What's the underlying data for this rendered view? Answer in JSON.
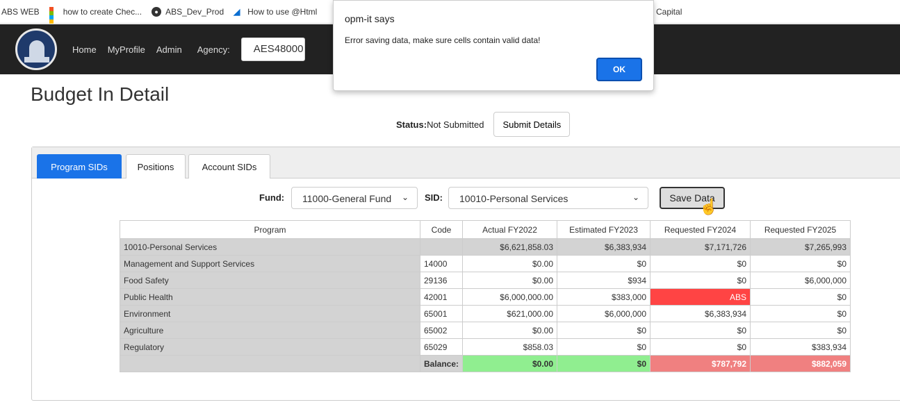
{
  "bookmarks": [
    {
      "label": "ABS WEB",
      "icon": "none"
    },
    {
      "label": "how to create Chec...",
      "icon": "microsoft-icon"
    },
    {
      "label": "ABS_Dev_Prod",
      "icon": "github-icon"
    },
    {
      "label": "How to use @Html",
      "icon": "azure-icon"
    },
    {
      "label": "Capital",
      "icon": "none"
    }
  ],
  "nav": {
    "home": "Home",
    "profile": "MyProfile",
    "admin": "Admin",
    "agency_label": "Agency:",
    "agency_value": "AES48000"
  },
  "page": {
    "title": "Budget In Detail",
    "status_label": "Status:",
    "status_value": "Not Submitted",
    "submit_label": "Submit Details"
  },
  "tabs": [
    {
      "label": "Program SIDs",
      "active": true
    },
    {
      "label": "Positions",
      "active": false
    },
    {
      "label": "Account SIDs",
      "active": false
    }
  ],
  "filters": {
    "fund_label": "Fund:",
    "fund_value": "11000-General Fund",
    "sid_label": "SID:",
    "sid_value": "10010-Personal Services",
    "save_label": "Save Data"
  },
  "table": {
    "headers": [
      "Program",
      "Code",
      "Actual FY2022",
      "Estimated FY2023",
      "Requested FY2024",
      "Requested FY2025"
    ],
    "summary": {
      "program": "10010-Personal Services",
      "code": "",
      "values": [
        "$6,621,858.03",
        "$6,383,934",
        "$7,171,726",
        "$7,265,993"
      ]
    },
    "rows": [
      {
        "program": "Management and Support Services",
        "code": "14000",
        "values": [
          "$0.00",
          "$0",
          "$0",
          "$0"
        ]
      },
      {
        "program": "Food Safety",
        "code": "29136",
        "values": [
          "$0.00",
          "$934",
          "$0",
          "$6,000,000"
        ]
      },
      {
        "program": "Public Health",
        "code": "42001",
        "values": [
          "$6,000,000.00",
          "$383,000",
          "ABS",
          "$0"
        ]
      },
      {
        "program": "Environment",
        "code": "65001",
        "values": [
          "$621,000.00",
          "$6,000,000",
          "$6,383,934",
          "$0"
        ]
      },
      {
        "program": "Agriculture",
        "code": "65002",
        "values": [
          "$0.00",
          "$0",
          "$0",
          "$0"
        ]
      },
      {
        "program": "Regulatory",
        "code": "65029",
        "values": [
          "$858.03",
          "$0",
          "$0",
          "$383,934"
        ]
      }
    ],
    "balance": {
      "label": "Balance:",
      "values": [
        "$0.00",
        "$0",
        "$787,792",
        "$882,059"
      ]
    }
  },
  "dialog": {
    "title": "opm-it says",
    "message": "Error saving data, make sure cells contain valid data!",
    "ok_label": "OK"
  },
  "colors": {
    "active_tab": "#1a73e8",
    "error_cell": "#ff4444",
    "balance_ok": "#90ee90",
    "balance_bad": "#f08080"
  }
}
